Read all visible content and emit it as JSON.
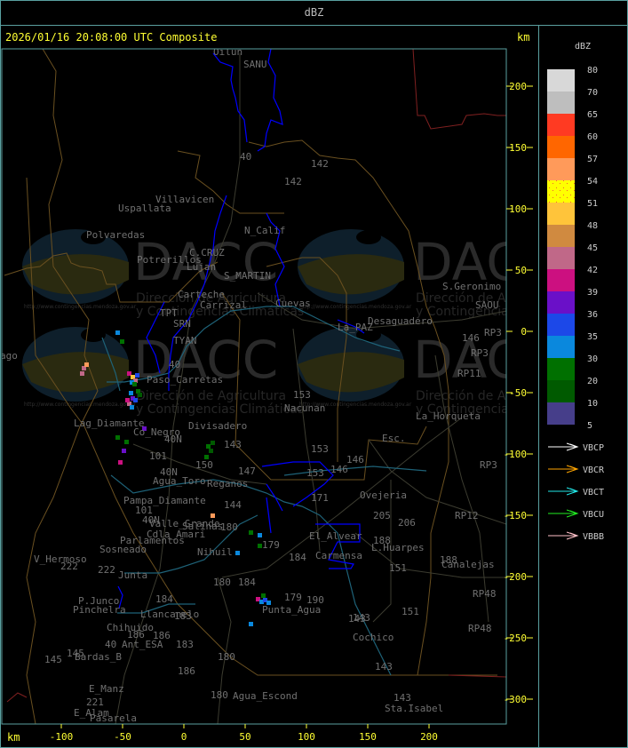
{
  "header": {
    "title": "dBZ"
  },
  "main": {
    "title": "2026/01/16 20:08:00 UTC Composite",
    "unit_top": "km",
    "unit_bottom": "km",
    "x_ticks": [
      -100,
      -50,
      0,
      50,
      100,
      150,
      200
    ],
    "y_ticks": [
      200,
      150,
      100,
      50,
      0,
      -50,
      -100,
      -150,
      -200,
      -250,
      -300
    ]
  },
  "legend": {
    "title": "dBZ",
    "levels": [
      "80",
      "70",
      "65",
      "60",
      "57",
      "54",
      "51",
      "48",
      "45",
      "42",
      "39",
      "36",
      "35",
      "30",
      "20",
      "10",
      "5"
    ],
    "colors": [
      "#d8d8d8",
      "#bebebe",
      "#ff3a22",
      "#ff6600",
      "#ff9a5a",
      "#ffff00",
      "#ffc43a",
      "#d08a40",
      "#c06888",
      "#cc1080",
      "#6a10c8",
      "#1c48e8",
      "#0a88dd",
      "#007000",
      "#005a00",
      "#463e8a"
    ],
    "radars": [
      {
        "name": "VBCP",
        "color": "#ffffff"
      },
      {
        "name": "VBCR",
        "color": "#ffa500"
      },
      {
        "name": "VBCT",
        "color": "#22e8e8"
      },
      {
        "name": "VBCU",
        "color": "#22ee22"
      },
      {
        "name": "VBBB",
        "color": "#ffc0c8"
      }
    ]
  },
  "watermark": {
    "logo_text": "DACC",
    "line1": "Dirección de Agricultura",
    "line2": "y Contingencias Climáticas",
    "url": "http://www.contingencias.mendoza.gov.ar"
  },
  "places": [
    "Oilun",
    "SANU",
    "40",
    "142",
    "142",
    "Villavicen",
    "Uspallata",
    "Polvaredas",
    "N_Calif",
    "C.CRUZ",
    "Potrerillos",
    "Lujan",
    "S_MARTIN",
    "Carteche",
    "Carrizal",
    "Cuevas",
    "La_PAZ",
    "Desaguadero",
    "S.Geronimo",
    "SAOU",
    "146",
    "RP3",
    "RP3",
    "RP11",
    "TPT",
    "SRN",
    "TYAN",
    "40",
    "Paso_Carretas",
    "Lag_Diamante",
    "Co_Negro",
    "Divisadero",
    "153",
    "Nacunan",
    "La_Horqueta",
    "Esc.",
    "143",
    "40N",
    "153",
    "146",
    "101",
    "150",
    "147",
    "40N",
    "Agua_Toro",
    "Reganos",
    "153",
    "146",
    "171",
    "Ovejeria",
    "205",
    "206",
    "RP3",
    "RP12",
    "Pampa_Diamante",
    "101",
    "144",
    "Valle_Grande",
    "40N",
    "Salinas",
    "180",
    "Cdla_Amari",
    "Parlamentos",
    "Sosneado",
    "Nihuil",
    "179",
    "184",
    "El_Alvear",
    "188",
    "L.Huarpes",
    "188",
    "Canalejas",
    "151",
    "V_Hermoso",
    "222",
    "222",
    "Junta",
    "P.Junco",
    "Pinchelra",
    "184",
    "180",
    "184",
    "183",
    "Llancanelo",
    "179",
    "190",
    "Punta_Agua",
    "RP48",
    "151",
    "143",
    "RP48",
    "Chihuido",
    "186",
    "186",
    "40",
    "Ant_ESA",
    "183",
    "Cochico",
    "145",
    "145",
    "Bardas_B",
    "180",
    "186",
    "143",
    "E_Manz",
    "180",
    "Agua_Escond",
    "143",
    "221",
    "E_Alam",
    "Sta.Isabel",
    "Pasarela",
    "ago",
    "Carmensa",
    "143"
  ]
}
